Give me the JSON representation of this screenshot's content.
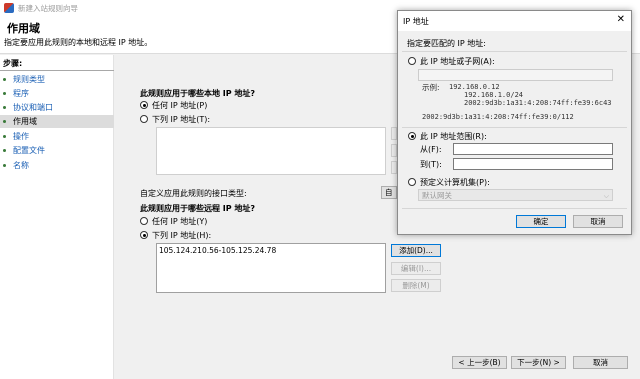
{
  "window": {
    "title": "新建入站规则向导"
  },
  "header": {
    "title": "作用域",
    "subtitle": "指定要应用此规则的本地和远程 IP 地址。"
  },
  "steps": {
    "header": "步骤:",
    "items": [
      {
        "label": "规则类型"
      },
      {
        "label": "程序"
      },
      {
        "label": "协议和端口"
      },
      {
        "label": "作用域"
      },
      {
        "label": "操作"
      },
      {
        "label": "配置文件"
      },
      {
        "label": "名称"
      }
    ]
  },
  "local": {
    "question": "此规则应用于哪些本地 IP 地址?",
    "any_label": "任何 IP 地址(P)",
    "list_label": "下列 IP 地址(T):",
    "any_selected": true
  },
  "interface_label": "自定义应用此规则的接口类型:",
  "interface_button": "自",
  "remote": {
    "question": "此规则应用于哪些远程 IP 地址?",
    "any_label": "任何 IP 地址(Y)",
    "list_label": "下列 IP 地址(H):",
    "list_selected": true,
    "entries": [
      "105.124.210.56-105.125.24.78"
    ],
    "add_button": "添加(D)...",
    "edit_button": "编辑(I)...",
    "remove_button": "删除(M)"
  },
  "footer": {
    "back": "< 上一步(B)",
    "next": "下一步(N) >",
    "cancel": "取消"
  },
  "dialog": {
    "title": "IP 地址",
    "prompt": "指定要匹配的 IP 地址:",
    "opt_subnet": "此 IP 地址或子网(A):",
    "example_label": "示例:",
    "examples": [
      "192.168.0.12",
      "192.168.1.0/24",
      "2002:9d3b:1a31:4:208:74ff:fe39:6c43",
      "2002:9d3b:1a31:4:208:74ff:fe39:0/112"
    ],
    "opt_range": "此 IP 地址范围(R):",
    "from_label": "从(F):",
    "to_label": "到(T):",
    "opt_predefined": "预定义计算机集(P):",
    "predefined_value": "默认网关",
    "ok": "确定",
    "cancel": "取消",
    "selected": "range"
  }
}
